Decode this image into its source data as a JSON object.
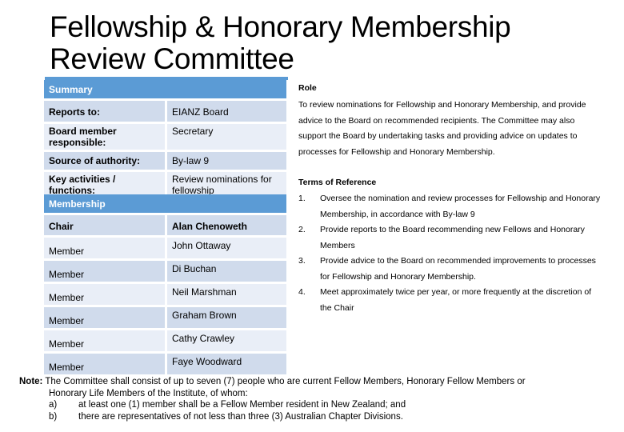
{
  "page": {
    "title_line1": "Fellowship & Honorary Membership",
    "title_line2": "Review Committee"
  },
  "colors": {
    "header_blue": "#5b9bd5",
    "row_dark": "#d0dbec",
    "row_light": "#e9eef7"
  },
  "summary": {
    "header": "Summary",
    "rows": [
      {
        "label": "Reports to:",
        "value": "EIANZ Board"
      },
      {
        "label": "Board member responsible:",
        "value": "Secretary"
      },
      {
        "label": "Source of authority:",
        "value": "By-law 9"
      },
      {
        "label": "Key activities / functions:",
        "value": "Review nominations for fellowship"
      }
    ]
  },
  "membership": {
    "header": "Membership",
    "rows": [
      {
        "role": "Chair",
        "name": "Alan Chenoweth"
      },
      {
        "role": "Member",
        "name": "John Ottaway"
      },
      {
        "role": "Member",
        "name": "Di Buchan"
      },
      {
        "role": "Member",
        "name": "Neil Marshman"
      },
      {
        "role": "Member",
        "name": "Graham Brown"
      },
      {
        "role": "Member",
        "name": "Cathy Crawley"
      },
      {
        "role": "Member",
        "name": "Faye Woodward"
      }
    ]
  },
  "role": {
    "heading": "Role",
    "lines": [
      "To review nominations for Fellowship and Honorary Membership, and provide",
      "advice to the Board on recommended recipients. The Committee may also",
      "support the Board by undertaking tasks and providing advice on updates to",
      "processes for Fellowship and Honorary Membership."
    ]
  },
  "terms": {
    "heading": "Terms of Reference",
    "items": [
      {
        "num": "1.",
        "lines": [
          "Oversee the nomination and review processes for Fellowship and Honorary",
          "Membership, in accordance with By-law 9"
        ]
      },
      {
        "num": "2.",
        "lines": [
          "Provide reports to the Board recommending new Fellows and Honorary",
          "Members"
        ]
      },
      {
        "num": "3.",
        "lines": [
          "Provide advice to the Board on recommended improvements to processes",
          "for Fellowship and Honorary Membership."
        ]
      },
      {
        "num": "4.",
        "lines": [
          "Meet approximately twice per year, or more frequently at the discretion of",
          "the Chair"
        ]
      }
    ]
  },
  "note": {
    "label": "Note:",
    "line1": "The Committee shall consist of up to seven (7) people who are current Fellow Members, Honorary Fellow Members or",
    "line2": "Honorary Life Members of the Institute, of whom:",
    "subitems": [
      {
        "key": "a)",
        "text": "at least one (1) member shall be a Fellow Member resident in New Zealand; and"
      },
      {
        "key": "b)",
        "text": "there are representatives of not less than three (3) Australian Chapter Divisions."
      }
    ]
  }
}
